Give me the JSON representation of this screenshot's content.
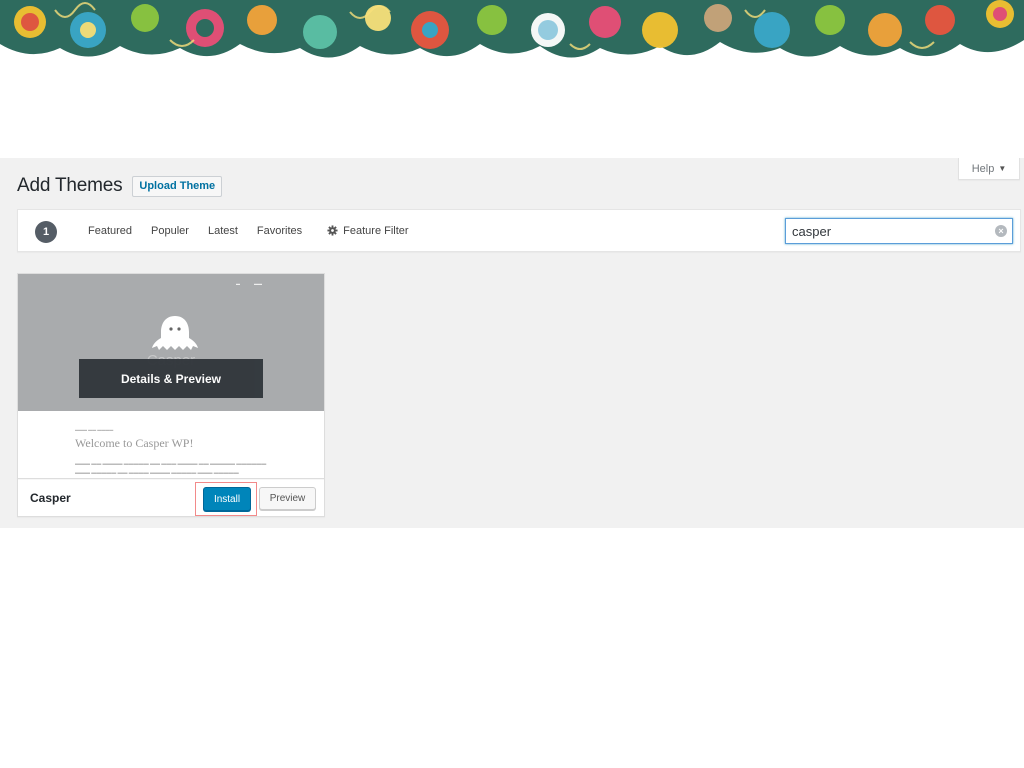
{
  "header": {
    "title": "Add Themes",
    "upload_label": "Upload Theme",
    "help_label": "Help"
  },
  "filter_bar": {
    "count": "1",
    "links": [
      "Featured",
      "Populer",
      "Latest",
      "Favorites"
    ],
    "feature_filter_label": "Feature Filter",
    "search_value": "casper"
  },
  "theme": {
    "name": "Casper",
    "screenshot_title": "Casper",
    "details_label": "Details & Preview",
    "post_title": "Welcome to Casper WP!",
    "install_label": "Install",
    "preview_label": "Preview"
  },
  "colors": {
    "primary_button": "#0085ba",
    "link_blue": "#0071a1",
    "highlight_border": "#f28a8a",
    "screen_bg": "#f1f1f1"
  },
  "icons": [
    "ghost-icon",
    "gear-icon",
    "clear-search-icon",
    "caret-down-icon"
  ]
}
